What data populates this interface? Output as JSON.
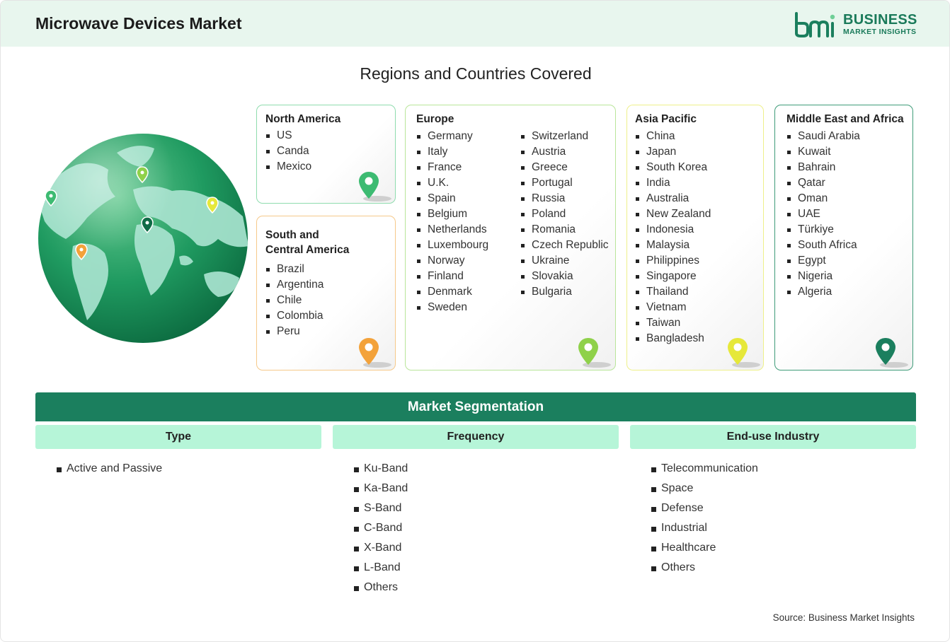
{
  "header": {
    "title": "Microwave Devices Market"
  },
  "logo": {
    "line1": "BUSINESS",
    "line2": "MARKET INSIGHTS"
  },
  "regions_title": "Regions and Countries Covered",
  "regions": {
    "north_america": {
      "title": "North America",
      "countries": [
        "US",
        "Canda",
        "Mexico"
      ],
      "color": "#3dbb72"
    },
    "south_central_america": {
      "title_line1": "South and",
      "title_line2": "Central America",
      "countries": [
        "Brazil",
        "Argentina",
        "Chile",
        "Colombia",
        "Peru"
      ],
      "color": "#f3a23a"
    },
    "europe": {
      "title": "Europe",
      "countries_col1": [
        "Germany",
        "Italy",
        "France",
        "U.K.",
        "Spain",
        "Belgium",
        "Netherlands",
        "Luxembourg",
        "Norway",
        "Finland",
        "Denmark",
        "Sweden"
      ],
      "countries_col2": [
        "Switzerland",
        "Austria",
        "Greece",
        "Portugal",
        "Russia",
        "Poland",
        "Romania",
        "Czech Republic",
        "Ukraine",
        "Slovakia",
        "Bulgaria"
      ],
      "color": "#8fd14a"
    },
    "asia_pacific": {
      "title": "Asia Pacific",
      "countries": [
        "China",
        "Japan",
        "South Korea",
        "India",
        "Australia",
        "New Zealand",
        "Indonesia",
        "Malaysia",
        "Philippines",
        "Singapore",
        "Thailand",
        "Vietnam",
        "Taiwan",
        "Bangladesh"
      ],
      "color": "#e6e83a"
    },
    "middle_east_africa": {
      "title": "Middle East and Africa",
      "countries": [
        "Saudi Arabia",
        "Kuwait",
        "Bahrain",
        "Qatar",
        "Oman",
        "UAE",
        "Türkiye",
        "South Africa",
        "Egypt",
        "Nigeria",
        "Algeria"
      ],
      "color": "#1b7f5e"
    }
  },
  "segmentation": {
    "title": "Market Segmentation",
    "columns": [
      {
        "header": "Type",
        "items": [
          "Active and Passive"
        ]
      },
      {
        "header": "Frequency",
        "items": [
          "Ku-Band",
          "Ka-Band",
          "S-Band",
          "C-Band",
          "X-Band",
          "L-Band",
          "Others"
        ]
      },
      {
        "header": "End-use Industry",
        "items": [
          "Telecommunication",
          "Space",
          "Defense",
          "Industrial",
          "Healthcare",
          "Others"
        ]
      }
    ]
  },
  "source": "Source: Business Market Insights",
  "icons": {
    "logo": "bmi-logo-icon",
    "globe": "globe-icon",
    "pin": "map-pin-icon"
  }
}
